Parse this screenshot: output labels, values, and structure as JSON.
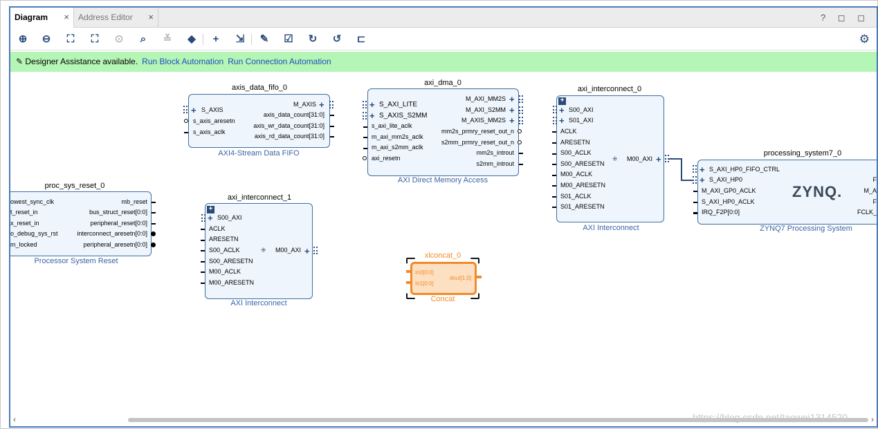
{
  "tabs": [
    {
      "label": "Diagram",
      "close": "×"
    },
    {
      "label": "Address Editor",
      "close": "×"
    }
  ],
  "window_controls": "? ◻ ◻",
  "toolbar": {
    "icons": [
      "zoom-in-icon",
      "zoom-out-icon",
      "fit-icon",
      "fit-selection-icon",
      "auto-connect-icon",
      "search-icon",
      "collapse-icon",
      "expand-icon",
      "add-ip-icon",
      "route-icon",
      "properties-icon",
      "validate-icon",
      "refresh-icon",
      "regenerate-icon",
      "pin-icon"
    ],
    "settings": "settings-icon"
  },
  "assist": {
    "text": "Designer Assistance available.",
    "link1": "Run Block Automation",
    "link2": "Run Connection Automation"
  },
  "blocks": {
    "proc_sys_reset": {
      "name": "proc_sys_reset_0",
      "type": "Processor System Reset",
      "left": [
        "owest_sync_clk",
        "t_reset_in",
        "x_reset_in",
        "o_debug_sys_rst",
        "m_locked"
      ],
      "right": [
        "mb_reset",
        "bus_struct_reset[0:0]",
        "peripheral_reset[0:0]",
        "interconnect_aresetn[0:0]",
        "peripheral_aresetn[0:0]"
      ]
    },
    "axis_fifo": {
      "name": "axis_data_fifo_0",
      "type": "AXI4-Stream Data FIFO",
      "left": [
        "S_AXIS",
        "s_axis_aresetn",
        "s_axis_aclk"
      ],
      "right": [
        "M_AXIS",
        "axis_data_count[31:0]",
        "axis_wr_data_count[31:0]",
        "axis_rd_data_count[31:0]"
      ]
    },
    "axi_dma": {
      "name": "axi_dma_0",
      "type": "AXI Direct Memory Access",
      "left": [
        "S_AXI_LITE",
        "S_AXIS_S2MM",
        "s_axi_lite_aclk",
        "m_axi_mm2s_aclk",
        "m_axi_s2mm_aclk",
        "axi_resetn"
      ],
      "right": [
        "M_AXI_MM2S",
        "M_AXI_S2MM",
        "M_AXIS_MM2S",
        "mm2s_prmry_reset_out_n",
        "s2mm_prmry_reset_out_n",
        "mm2s_introut",
        "s2mm_introut"
      ]
    },
    "ic0": {
      "name": "axi_interconnect_0",
      "type": "AXI Interconnect",
      "left": [
        "S00_AXI",
        "S01_AXI",
        "ACLK",
        "ARESETN",
        "S00_ACLK",
        "S00_ARESETN",
        "M00_ACLK",
        "M00_ARESETN",
        "S01_ACLK",
        "S01_ARESETN"
      ],
      "right": [
        "M00_AXI"
      ]
    },
    "ic1": {
      "name": "axi_interconnect_1",
      "type": "AXI Interconnect",
      "left": [
        "S00_AXI",
        "ACLK",
        "ARESETN",
        "S00_ACLK",
        "S00_ARESETN",
        "M00_ACLK",
        "M00_ARESETN"
      ],
      "right": [
        "M00_AXI"
      ]
    },
    "ps7": {
      "name": "processing_system7_0",
      "type": "ZYNQ7 Processing System",
      "logo": "ZYNQ.",
      "left": [
        "S_AXI_HP0_FIFO_CTRL",
        "S_AXI_HP0",
        "M_AXI_GP0_ACLK",
        "S_AXI_HP0_ACLK",
        "IRQ_F2P[0:0]"
      ],
      "right": [
        "F",
        "M_A",
        "F",
        "FCLK_"
      ]
    },
    "concat": {
      "name": "xlconcat_0",
      "type": "Concat",
      "left": [
        "In0[0:0]",
        "In1[0:0]"
      ],
      "right": [
        "dout[1:0]"
      ]
    }
  },
  "colors": {
    "accent": "#2a4a78",
    "assist_bg": "#b5f5b5",
    "block_bg": "#eef5fc",
    "concat": "#f08a2a"
  },
  "watermark": "https://blog.csdn.net/taowei1314520"
}
